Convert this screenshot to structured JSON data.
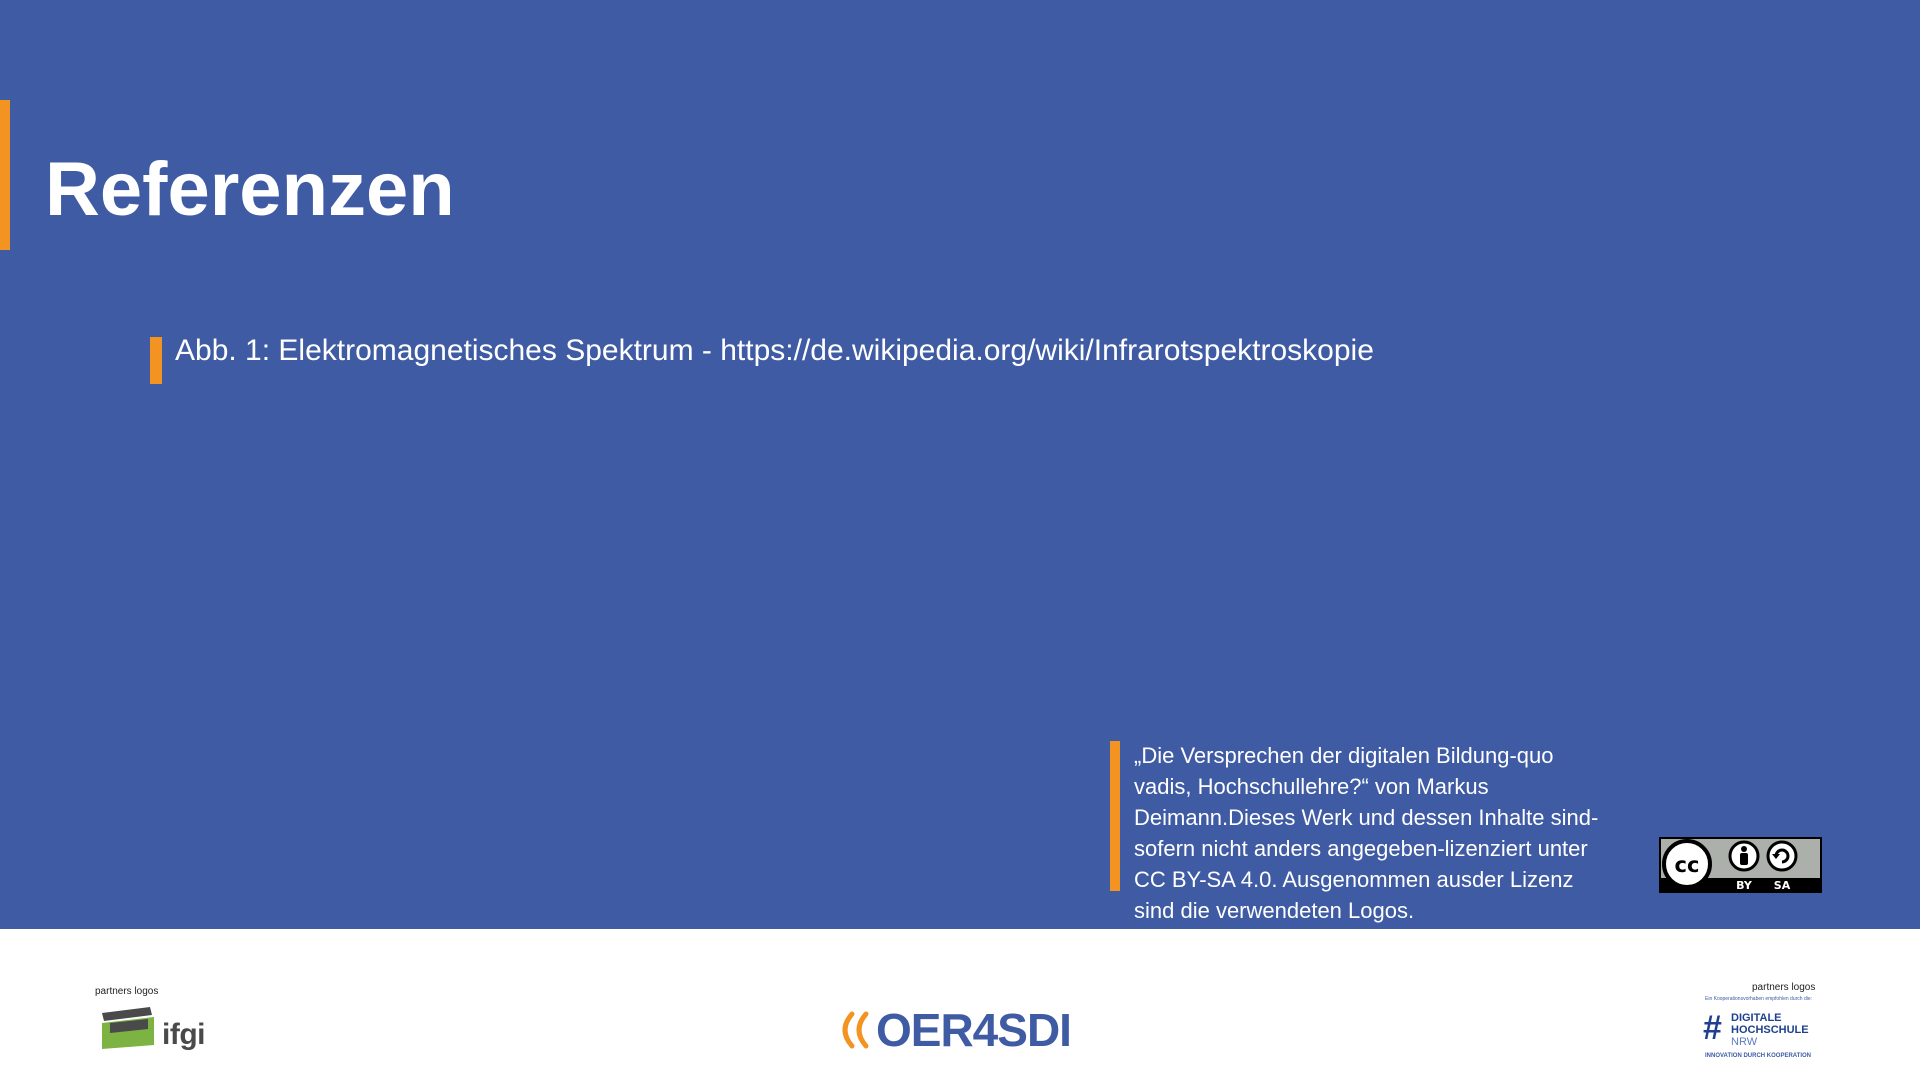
{
  "slide": {
    "title": "Referenzen",
    "reference": "Abb. 1: Elektromagnetisches Spektrum - https://de.wikipedia.org/wiki/Infrarotspektroskopie",
    "quote_lines": [
      "„Die Versprechen der digitalen Bildung-quo",
      "vadis, Hochschullehre?“ von Markus",
      "Deimann.Dieses Werk und dessen Inhalte sind-",
      "sofern nicht anders angegeben-lizenziert unter",
      "CC BY-SA 4.0. Ausgenommen ausder Lizenz",
      "sind die verwendeten Logos."
    ],
    "license_badge": {
      "left": "BY",
      "right": "SA",
      "icon": "cc-by-sa-icon"
    }
  },
  "footer": {
    "left_label": "partners logos",
    "left_logo_text": "ifgi",
    "center_logo_text": "OER4SDI",
    "right_label": "partners logos",
    "right_small": "Ein Kooperationsvorhaben empfohlen durch die:",
    "right_line1": "DIGITALE",
    "right_line2": "HOCHSCHULE",
    "right_line3": "NRW",
    "right_tagline": "INNOVATION DURCH KOOPERATION"
  },
  "colors": {
    "slide_bg": "#3f5ba3",
    "accent": "#f39322",
    "text": "#ffffff",
    "footer_bg": "#ffffff"
  }
}
